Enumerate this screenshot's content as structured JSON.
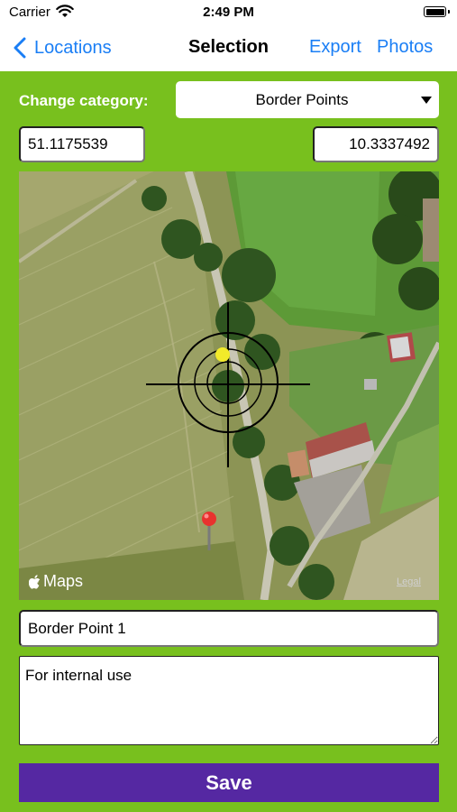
{
  "status_bar": {
    "carrier": "Carrier",
    "time": "2:49 PM",
    "icons": [
      "wifi-icon",
      "battery-icon"
    ]
  },
  "navbar": {
    "back_label": "Locations",
    "title": "Selection",
    "export_label": "Export",
    "photos_label": "Photos"
  },
  "category": {
    "label": "Change category:",
    "selected": "Border Points"
  },
  "coordinates": {
    "latitude": "51.1175539",
    "longitude": "10.3337492"
  },
  "map": {
    "attribution": "Maps",
    "legal_label": "Legal",
    "markers": [
      "crosshair-icon",
      "yellow-location-dot",
      "red-pin-icon"
    ]
  },
  "point": {
    "name": "Border Point 1",
    "note": "For internal use"
  },
  "save_label": "Save",
  "colors": {
    "accent": "#1a7ef5",
    "background_green": "#78c01e",
    "save_button": "#5528a2"
  }
}
